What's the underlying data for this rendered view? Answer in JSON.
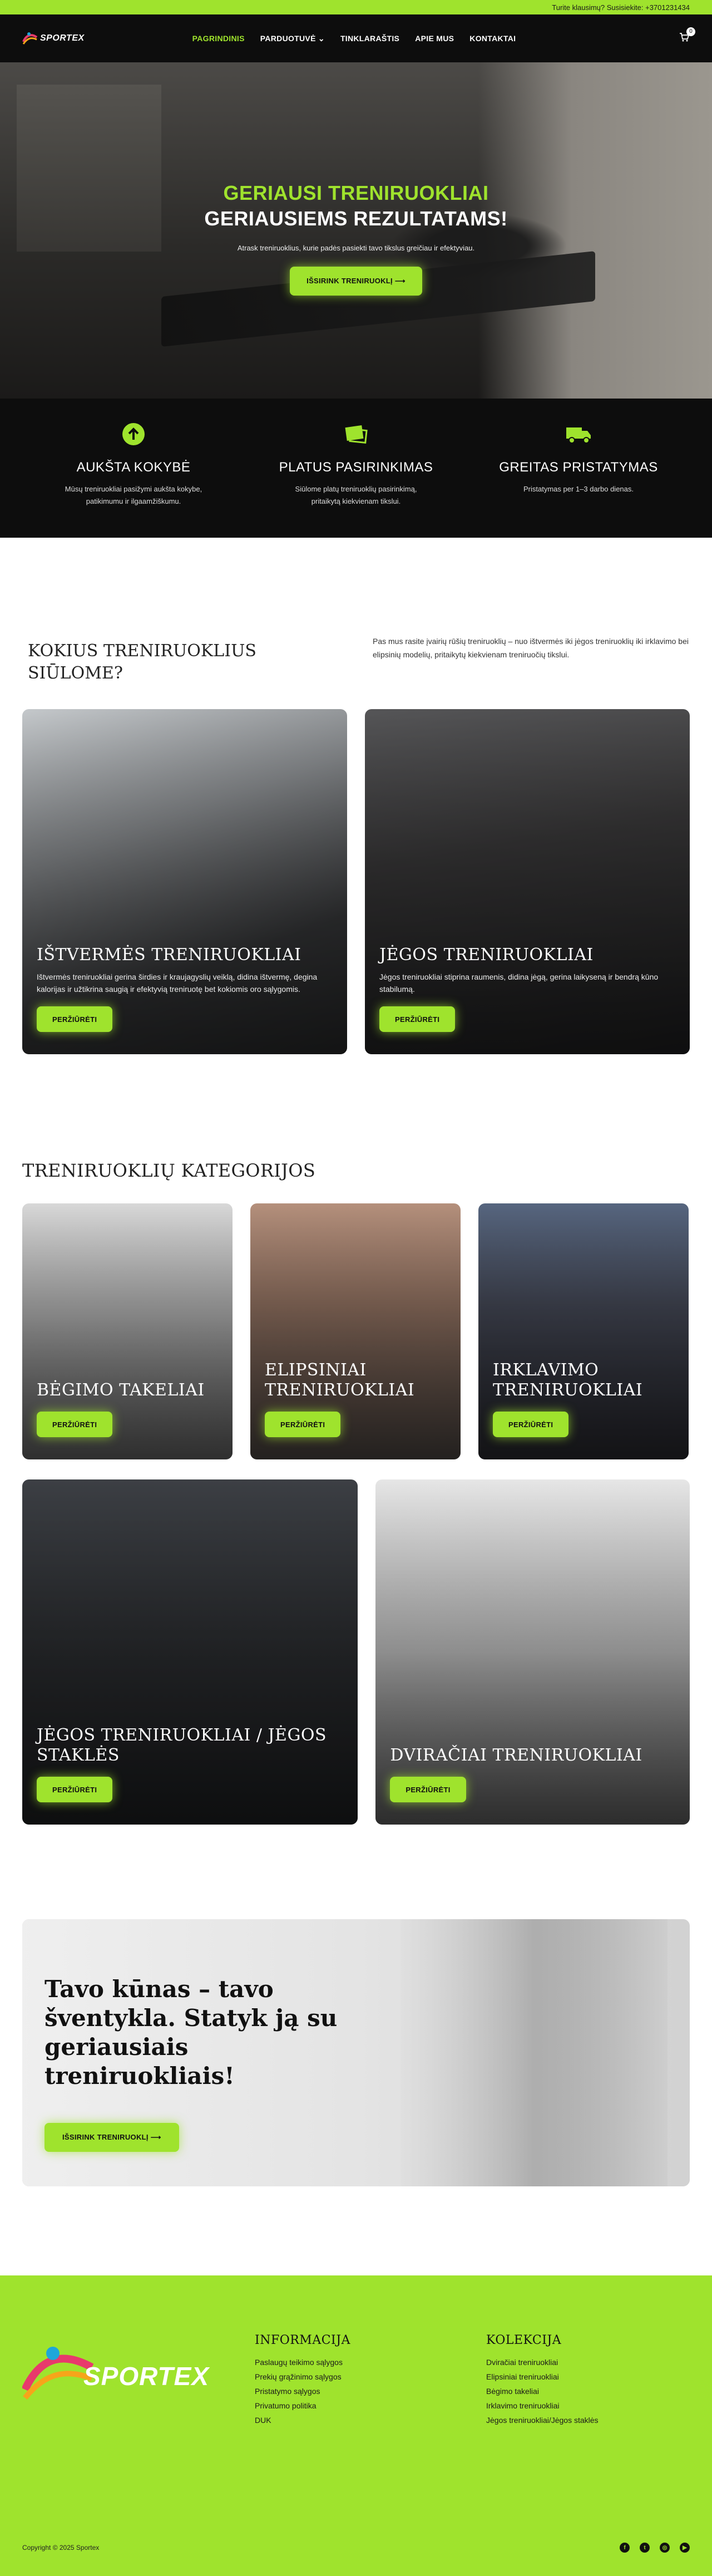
{
  "topbar": {
    "text": "Turite klausimų? Susisiekite: +3701231434"
  },
  "header": {
    "logo_text": "SPORTEX",
    "nav": [
      {
        "label": "PAGRINDINIS",
        "active": true
      },
      {
        "label": "PARDUOTUVĖ ⌄",
        "active": false
      },
      {
        "label": "TINKLARAŠTIS",
        "active": false
      },
      {
        "label": "APIE MUS",
        "active": false
      },
      {
        "label": "KONTAKTAI",
        "active": false
      }
    ],
    "cart_count": "0",
    "cart_icon": "cart-icon"
  },
  "hero": {
    "title_green": "GERIAUSI TRENIRUOKLIAI",
    "title_white": "GERIAUSIEMS REZULTATAMS!",
    "subtitle": "Atrask treniruoklius, kurie padės pasiekti tavo tikslus greičiau ir efektyviau.",
    "cta": "IŠSIRINK TRENIRUOKLĮ ⟶"
  },
  "features": [
    {
      "icon": "arrow-up-icon",
      "title": "AUKŠTA KOKYBĖ",
      "text": "Mūsų treniruokliai pasižymi aukšta kokybe, patikimumu ir ilgaamžiškumu."
    },
    {
      "icon": "selection-icon",
      "title": "PLATUS PASIRINKIMAS",
      "text": "Siūlome platų treniruoklių pasirinkimą, pritaikytą kiekvienam tikslui."
    },
    {
      "icon": "truck-icon",
      "title": "GREITAS PRISTATYMAS",
      "text": "Pristatymas per 1–3 darbo dienas."
    }
  ],
  "intro": {
    "title": "KOKIUS TRENIRUOKLIUS SIŪLOME?",
    "text": "Pas mus rasite įvairių rūšių treniruoklių – nuo ištvermės iki jėgos treniruoklių iki irklavimo bei elipsinių modelių, pritaikytų kiekvienam treniruočių tikslui."
  },
  "types": [
    {
      "title": "IŠTVERMĖS TRENIRUOKLIAI",
      "text": "Ištvermės treniruokliai gerina širdies ir kraujagyslių veiklą, didina ištvermę, degina kalorijas ir užtikrina saugią ir efektyvią treniruotę bet kokiomis oro sąlygomis.",
      "button": "PERŽIŪRĖTI"
    },
    {
      "title": "JĖGOS TRENIRUOKLIAI",
      "text": "Jėgos treniruokliai stiprina raumenis, didina jėgą, gerina laikyseną ir bendrą kūno stabilumą.",
      "button": "PERŽIŪRĖTI"
    }
  ],
  "categories": {
    "title": "TRENIRUOKLIŲ KATEGORIJOS",
    "row1": [
      {
        "title": "BĖGIMO TAKELIAI",
        "button": "PERŽIŪRĖTI"
      },
      {
        "title": "ELIPSINIAI TRENIRUOKLIAI",
        "button": "PERŽIŪRĖTI"
      },
      {
        "title": "IRKLAVIMO TRENIRUOKLIAI",
        "button": "PERŽIŪRĖTI"
      }
    ],
    "row2": [
      {
        "title": "JĖGOS TRENIRUOKLIAI / JĖGOS STAKLĖS",
        "button": "PERŽIŪRĖTI"
      },
      {
        "title": "DVIRAČIAI TRENIRUOKLIAI",
        "button": "PERŽIŪRĖTI"
      }
    ]
  },
  "banner": {
    "title": "Tavo kūnas – tavo šventykla. Statyk ją su geriausiais treniruokliais!",
    "cta": "IŠSIRINK TRENIRUOKLĮ ⟶"
  },
  "footer": {
    "brand": "SPORTEX",
    "info_title": "INFORMACIJA",
    "info_links": [
      "Paslaugų teikimo sąlygos",
      "Prekių grąžinimo sąlygos",
      "Pristatymo sąlygos",
      "Privatumo politika",
      "DUK"
    ],
    "collection_title": "KOLEKCIJA",
    "collection_links": [
      "Dviračiai treniruokliai",
      "Elipsiniai treniruokliai",
      "Bėgimo takeliai",
      "Irklavimo treniruokliai",
      "Jėgos treniruokliai/Jėgos staklės"
    ],
    "copyright": "Copyright © 2025 Sportex",
    "social": [
      {
        "icon": "facebook-icon",
        "glyph": "f"
      },
      {
        "icon": "twitter-icon",
        "glyph": "t"
      },
      {
        "icon": "instagram-icon",
        "glyph": "◎"
      },
      {
        "icon": "youtube-icon",
        "glyph": "▶"
      }
    ]
  },
  "colors": {
    "accent": "#9fe32d",
    "dark": "#0d0d0d"
  }
}
